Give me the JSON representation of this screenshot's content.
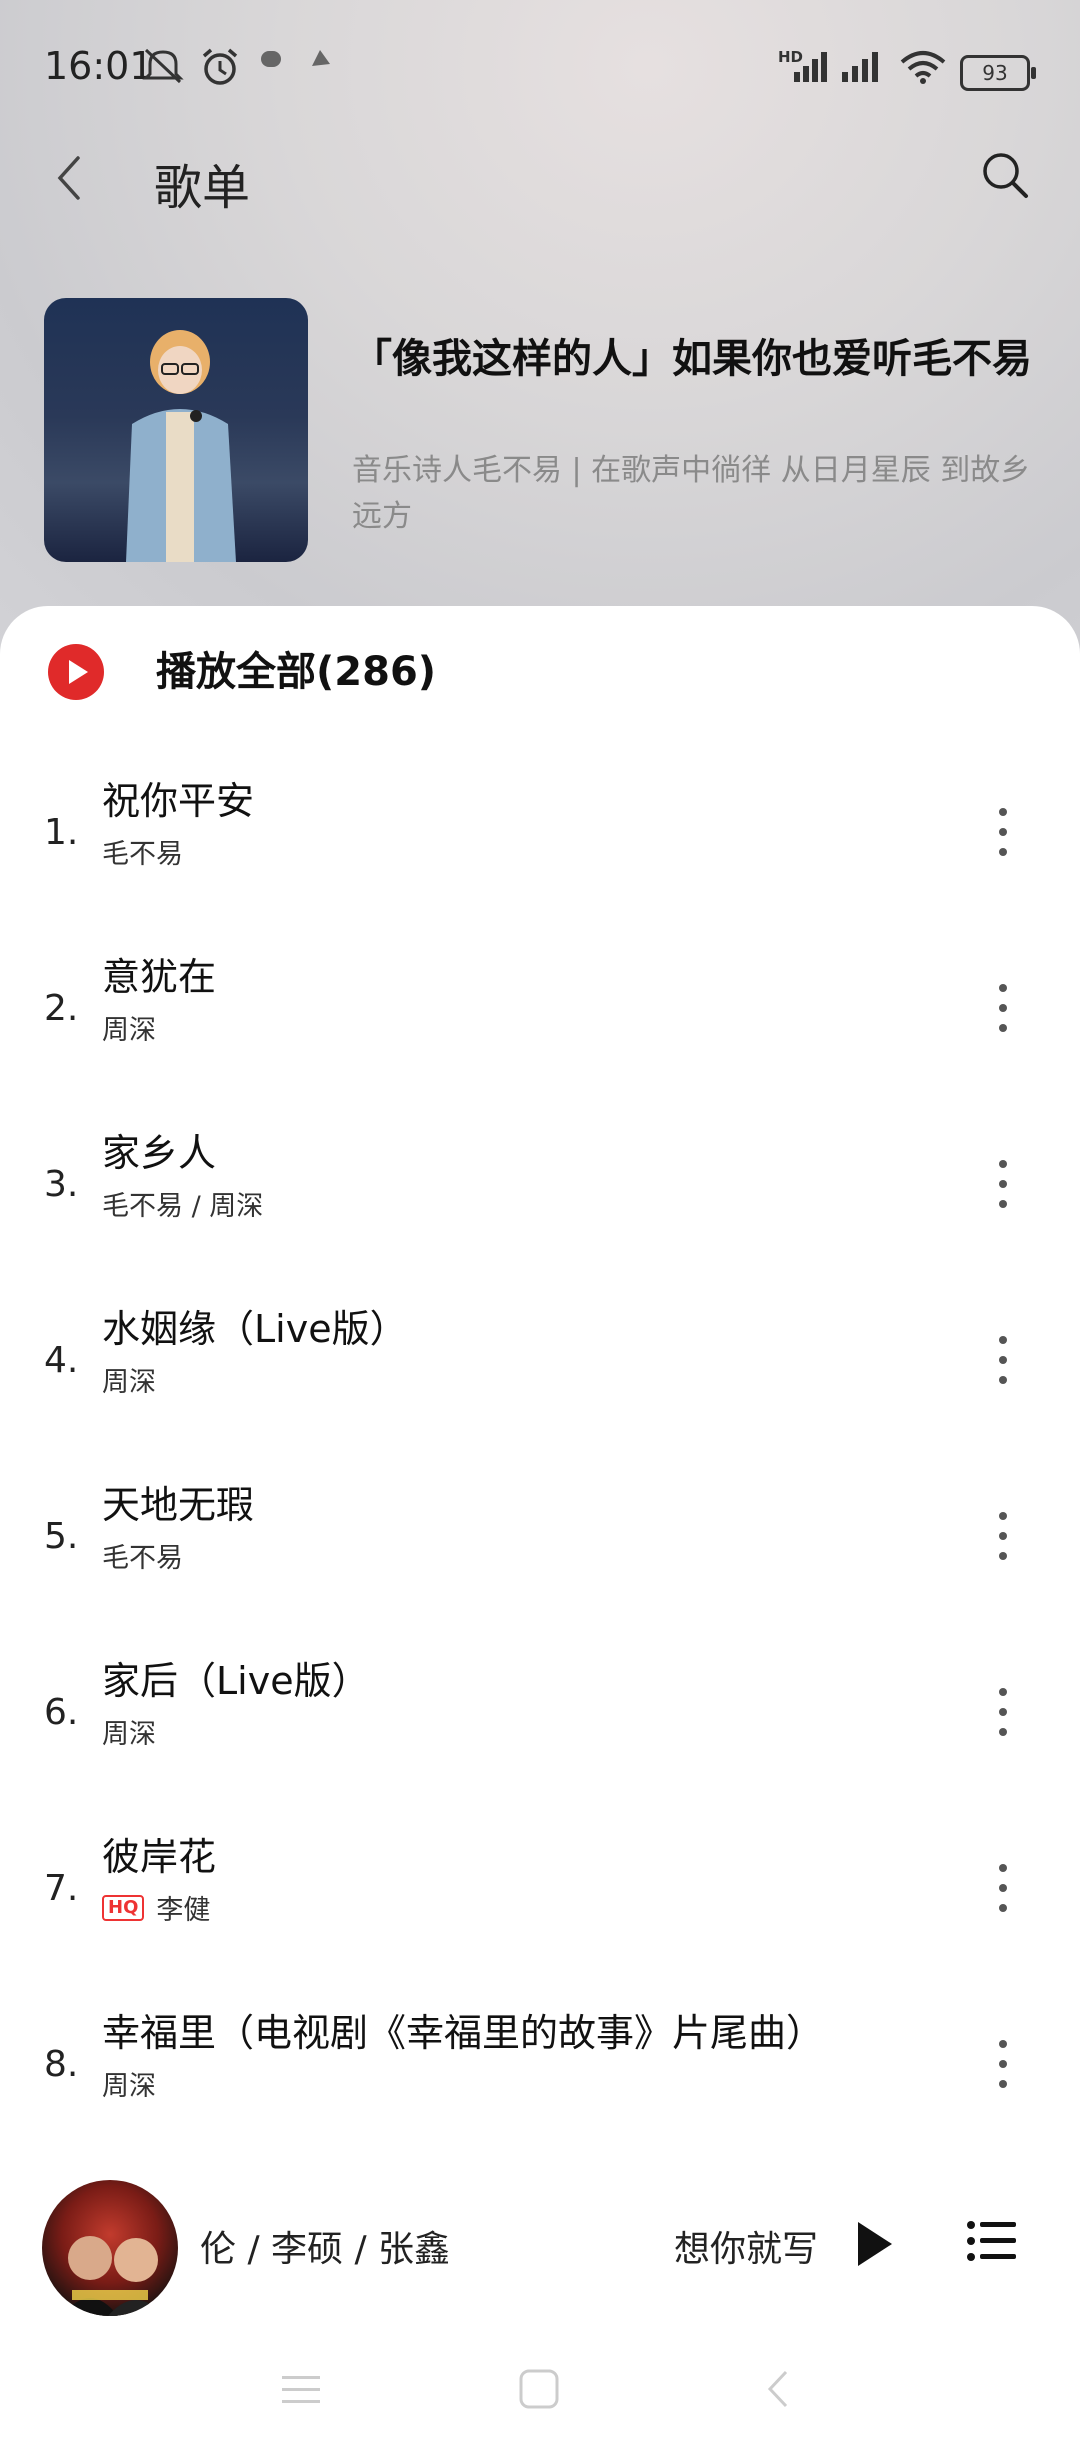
{
  "status_bar": {
    "time": "16:01",
    "icons": [
      "mute-icon",
      "alarm-icon",
      "notification-icon",
      "notification-icon"
    ],
    "network_label": "HD",
    "battery": "93"
  },
  "nav": {
    "title": "歌单",
    "back_icon": "chevron-left-icon",
    "search_icon": "search-icon"
  },
  "playlist": {
    "title": "「像我这样的人」如果你也爱听毛不易",
    "description": "音乐诗人毛不易 | 在歌声中徜徉 从日月星辰 到故乡远方"
  },
  "play_all": {
    "label": "播放全部(286)"
  },
  "songs": [
    {
      "index": "1.",
      "title": "祝你平安",
      "artist": "毛不易",
      "hq": false
    },
    {
      "index": "2.",
      "title": "意犹在",
      "artist": "周深",
      "hq": false
    },
    {
      "index": "3.",
      "title": "家乡人",
      "artist": "毛不易 / 周深",
      "hq": false
    },
    {
      "index": "4.",
      "title": "水姻缘（Live版）",
      "artist": "周深",
      "hq": false
    },
    {
      "index": "5.",
      "title": "天地无瑕",
      "artist": "毛不易",
      "hq": false
    },
    {
      "index": "6.",
      "title": "家后（Live版）",
      "artist": "周深",
      "hq": false
    },
    {
      "index": "7.",
      "title": "彼岸花",
      "artist": "李健",
      "hq": true,
      "hq_label": "HQ"
    },
    {
      "index": "8.",
      "title": "幸福里（电视剧《幸福里的故事》片尾曲）",
      "artist": "周深",
      "hq": false
    }
  ],
  "mini_player": {
    "artists_text": "伦 / 李硕 / 张鑫",
    "track_text": "想你就写",
    "play_icon": "play-icon",
    "list_icon": "playlist-icon"
  },
  "system_nav": {
    "icons": [
      "menu-icon",
      "home-icon",
      "back-icon"
    ]
  }
}
